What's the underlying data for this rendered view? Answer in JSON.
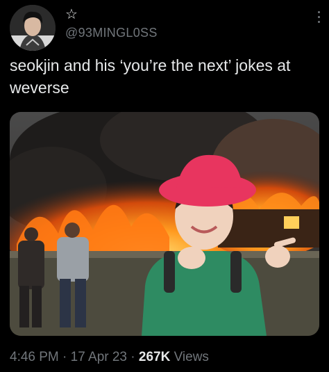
{
  "tweet": {
    "display_name": "☆",
    "handle": "@93MINGL0SS",
    "text": "seokjin and his ‘you’re the next’ jokes at weverse",
    "time": "4:46 PM",
    "separator": "·",
    "date": "17 Apr 23",
    "views_count": "267K",
    "views_label": "Views"
  },
  "icons": {
    "more": "more-options-icon"
  },
  "colors": {
    "background": "#000000",
    "text_primary": "#e7e9ea",
    "text_secondary": "#71767b",
    "fire": "#ff6a00",
    "hat": "#e8355f",
    "sweater": "#2e8b62"
  }
}
